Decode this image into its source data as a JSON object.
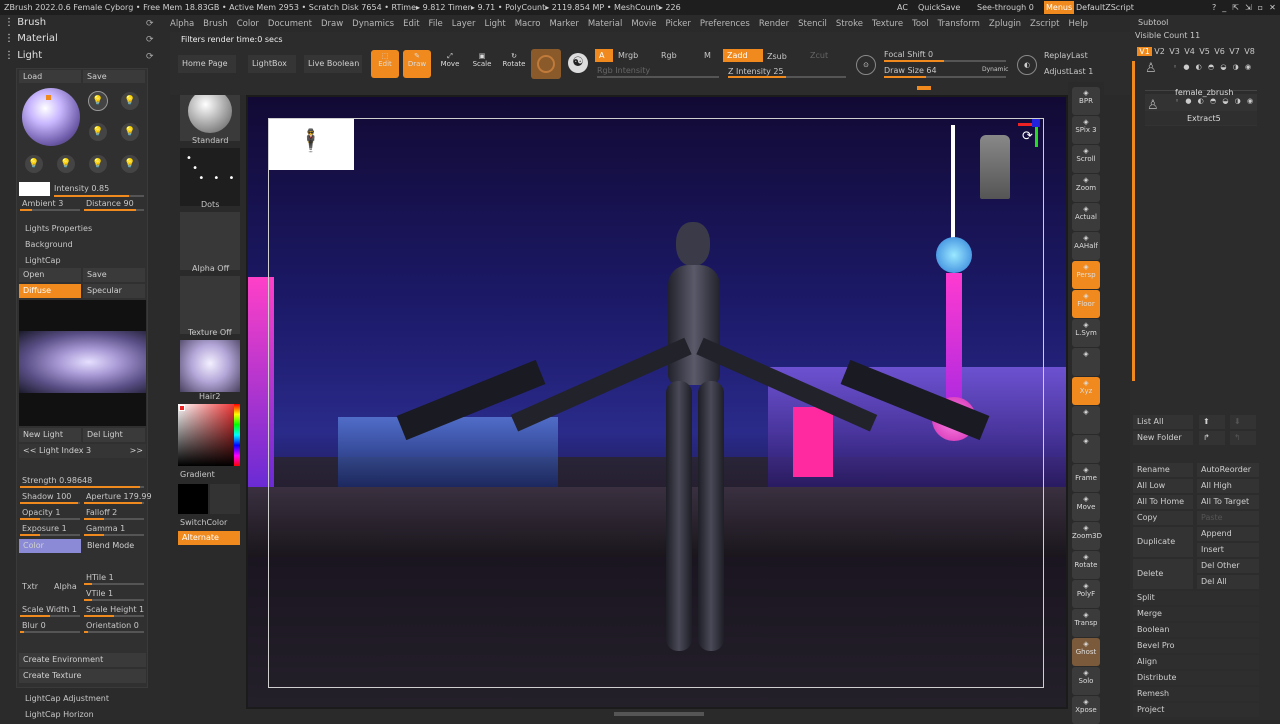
{
  "titlebar": {
    "text": "ZBrush 2022.0.6   Female Cyborg   • Free Mem 18.83GB • Active Mem 2953 • Scratch Disk 7654 • RTime▸ 9.812 Timer▸ 9.71 • PolyCount▸ 2119.854 MP • MeshCount▸ 226",
    "ac": "AC",
    "quicksave": "QuickSave",
    "seethrough": "See-through  0",
    "menus": "Menus",
    "defaultscript": "DefaultZScript"
  },
  "menu": [
    "Alpha",
    "Brush",
    "Color",
    "Document",
    "Draw",
    "Dynamics",
    "Edit",
    "File",
    "Layer",
    "Light",
    "Macro",
    "Marker",
    "Material",
    "Movie",
    "Picker",
    "Preferences",
    "Render",
    "Stencil",
    "Stroke",
    "Texture",
    "Tool",
    "Transform",
    "Zplugin",
    "Zscript",
    "Help"
  ],
  "left": {
    "brush": "Brush",
    "material": "Material",
    "light": "Light",
    "load": "Load",
    "save": "Save",
    "intensity": "Intensity 0.85",
    "ambient": "Ambient 3",
    "distance": "Distance 90",
    "lights_properties": "Lights Properties",
    "background": "Background",
    "lightcap": "LightCap",
    "open": "Open",
    "save2": "Save",
    "diffuse": "Diffuse",
    "specular": "Specular",
    "new_light": "New Light",
    "del_light": "Del Light",
    "light_index": "Light Index 3",
    "strength": "Strength 0.98648",
    "shadow": "Shadow 100",
    "aperture": "Aperture 179.99",
    "opacity": "Opacity 1",
    "falloff": "Falloff 2",
    "exposure": "Exposure 1",
    "gamma": "Gamma 1",
    "color": "Color",
    "blend_mode": "Blend Mode",
    "txtr": "Txtr",
    "alpha": "Alpha",
    "htile": "HTile 1",
    "vtile": "VTile 1",
    "scale_width": "Scale Width 1",
    "scale_height": "Scale Height 1",
    "blur": "Blur 0",
    "orientation": "Orientation 0",
    "create_env": "Create Environment",
    "create_tex": "Create Texture",
    "lightcap_adj": "LightCap Adjustment",
    "lightcap_horizon": "LightCap Horizon"
  },
  "shelf": {
    "standard": "Standard",
    "dots": "Dots",
    "alpha_off": "Alpha Off",
    "texture_off": "Texture Off",
    "hair2": "Hair2",
    "gradient": "Gradient",
    "switchcolor": "SwitchColor",
    "alternate": "Alternate"
  },
  "top": {
    "filters": "Filters render time:0 secs",
    "homepage": "Home Page",
    "lightbox": "LightBox",
    "live_boolean": "Live Boolean",
    "edit": "Edit",
    "draw": "Draw",
    "move": "Move",
    "scale": "Scale",
    "rotate": "Rotate",
    "a": "A",
    "mrgb": "Mrgb",
    "rgb": "Rgb",
    "m": "M",
    "rgb_intensity": "Rgb Intensity",
    "zadd": "Zadd",
    "zsub": "Zsub",
    "zcut": "Zcut",
    "z_intensity": "Z Intensity 25",
    "focal_shift": "Focal Shift 0",
    "draw_size": "Draw Size 64",
    "dynamic": "Dynamic",
    "replaylast": "ReplayLast",
    "adjustlast": "AdjustLast 1"
  },
  "right_icons": [
    "BPR",
    "SPix 3",
    "Scroll",
    "Zoom",
    "Actual",
    "AAHalf",
    "Persp",
    "Floor",
    "L.Sym",
    "",
    "Xyz",
    "",
    "",
    "Frame",
    "Move",
    "Zoom3D",
    "Rotate",
    "PolyF",
    "Transp",
    "Ghost",
    "Solo",
    "Xpose"
  ],
  "subtool": {
    "title": "Subtool",
    "visible_count": "Visible Count 11",
    "v_labels": [
      "V1",
      "V2",
      "V3",
      "V4",
      "V5",
      "V6",
      "V7",
      "V8"
    ],
    "item1": "female_zbrush",
    "item2": "Extract5",
    "list_all": "List All",
    "new_folder": "New Folder",
    "rename": "Rename",
    "autoreorder": "AutoReorder",
    "all_low": "All Low",
    "all_high": "All High",
    "all_to_home": "All To Home",
    "all_to_target": "All To Target",
    "copy": "Copy",
    "paste": "Paste",
    "duplicate": "Duplicate",
    "append": "Append",
    "insert": "Insert",
    "delete": "Delete",
    "del_other": "Del Other",
    "del_all": "Del All",
    "split": "Split",
    "merge": "Merge",
    "boolean": "Boolean",
    "bevel_pro": "Bevel Pro",
    "align": "Align",
    "distribute": "Distribute",
    "remesh": "Remesh",
    "project": "Project"
  }
}
